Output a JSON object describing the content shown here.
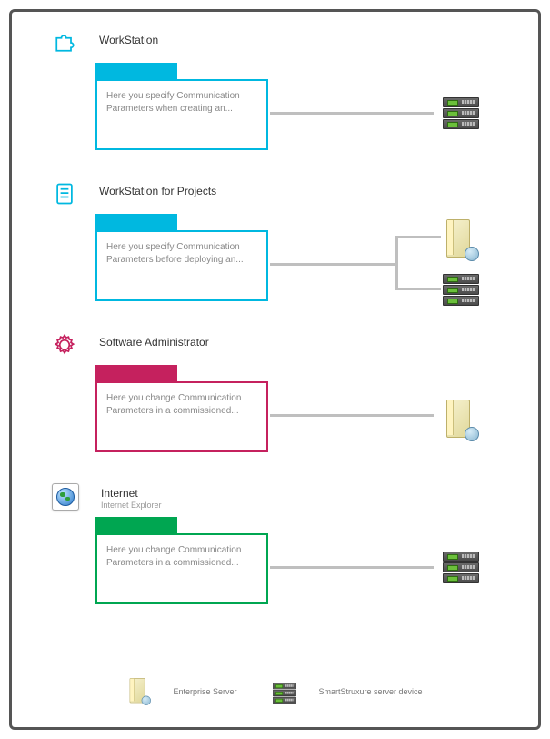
{
  "sections": [
    {
      "icon": "puzzle-icon",
      "icon_color": "#00b8e0",
      "title": "WorkStation",
      "subtitle": "",
      "color_class": "c-cyan",
      "folder_text": "Here you specify Communication Parameters when creating an...",
      "targets": [
        "rack"
      ]
    },
    {
      "icon": "doc-icon",
      "icon_color": "#00b8e0",
      "title": "WorkStation for Projects",
      "subtitle": "",
      "color_class": "c-cyan",
      "folder_text": "Here you specify Communication Parameters before deploying an...",
      "targets": [
        "tower",
        "rack"
      ]
    },
    {
      "icon": "gear-icon",
      "icon_color": "#c5215e",
      "title": "Software Administrator",
      "subtitle": "",
      "color_class": "c-pink",
      "folder_text": "Here you change Communication Parameters in a commissioned...",
      "targets": [
        "tower"
      ]
    },
    {
      "icon": "globe-icon",
      "icon_color": "#2a7acb",
      "title": "Internet",
      "subtitle": "Internet Explorer",
      "color_class": "c-green",
      "folder_text": "Here you change Communication Parameters in a commissioned...",
      "targets": [
        "rack"
      ]
    }
  ],
  "legend": {
    "enterprise_server": "Enterprise Server",
    "smartstruxure_device": "SmartStruxure server device"
  }
}
